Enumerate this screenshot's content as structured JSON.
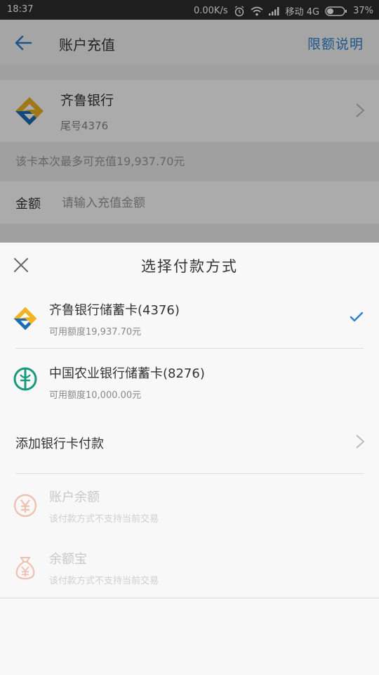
{
  "status_bar": {
    "time": "18:37",
    "speed": "0.00K/s",
    "carrier": "移动 4G",
    "battery": "37%"
  },
  "app_bar": {
    "title": "账户充值",
    "limit_link": "限额说明",
    "accent_color": "#2f7fd1"
  },
  "account": {
    "bank_name": "齐鲁银行",
    "tail": "尾号4376",
    "max_info": "该卡本次最多可充值19,937.70元",
    "amount_label": "金额",
    "amount_placeholder": "请输入充值金额"
  },
  "sheet": {
    "title": "选择付款方式",
    "options": [
      {
        "name": "齐鲁银行储蓄卡(4376)",
        "sub": "可用额度19,937.70元",
        "icon": "qilu-bank-logo-icon",
        "selected": true
      },
      {
        "name": "中国农业银行储蓄卡(8276)",
        "sub": "可用额度10,000.00元",
        "icon": "abc-bank-logo-icon",
        "selected": false
      }
    ],
    "add_card": "添加银行卡付款",
    "disabled_options": [
      {
        "name": "账户余额",
        "sub": "该付款方式不支持当前交易",
        "icon": "yuan-coin-icon"
      },
      {
        "name": "余额宝",
        "sub": "该付款方式不支持当前交易",
        "icon": "money-bag-icon"
      }
    ]
  }
}
